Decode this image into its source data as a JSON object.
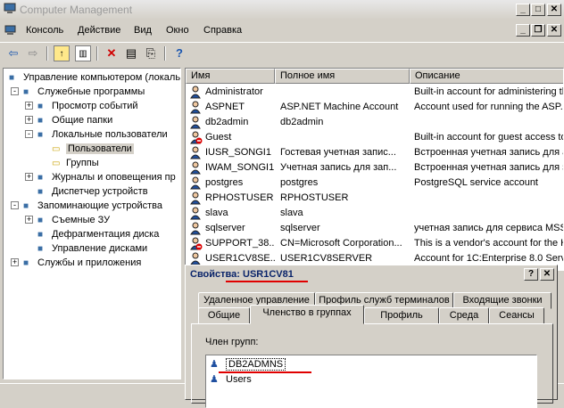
{
  "window": {
    "title": "Computer Management"
  },
  "menu": [
    "Консоль",
    "Действие",
    "Вид",
    "Окно",
    "Справка"
  ],
  "tree": {
    "items": [
      {
        "label": "Управление компьютером (локаль",
        "level": 0,
        "exp": ""
      },
      {
        "label": "Служебные программы",
        "level": 1,
        "exp": "-"
      },
      {
        "label": "Просмотр событий",
        "level": 2,
        "exp": "+"
      },
      {
        "label": "Общие папки",
        "level": 2,
        "exp": "+"
      },
      {
        "label": "Локальные пользователи",
        "level": 2,
        "exp": "-"
      },
      {
        "label": "Пользователи",
        "level": 3,
        "exp": ""
      },
      {
        "label": "Группы",
        "level": 3,
        "exp": ""
      },
      {
        "label": "Журналы и оповещения пр",
        "level": 2,
        "exp": "+"
      },
      {
        "label": "Диспетчер устройств",
        "level": 2,
        "exp": ""
      },
      {
        "label": "Запоминающие устройства",
        "level": 1,
        "exp": "-"
      },
      {
        "label": "Съемные ЗУ",
        "level": 2,
        "exp": "+"
      },
      {
        "label": "Дефрагментация диска",
        "level": 2,
        "exp": ""
      },
      {
        "label": "Управление дисками",
        "level": 2,
        "exp": ""
      },
      {
        "label": "Службы и приложения",
        "level": 1,
        "exp": "+"
      }
    ]
  },
  "list": {
    "columns": [
      "Имя",
      "Полное имя",
      "Описание"
    ],
    "rows": [
      {
        "name": "Administrator",
        "full": "",
        "desc": "Built-in account for administering th",
        "disabled": false
      },
      {
        "name": "ASPNET",
        "full": "ASP.NET Machine Account",
        "desc": "Account used for running the ASP.N",
        "disabled": false
      },
      {
        "name": "db2admin",
        "full": "db2admin",
        "desc": "",
        "disabled": false
      },
      {
        "name": "Guest",
        "full": "",
        "desc": "Built-in account for guest access to",
        "disabled": true
      },
      {
        "name": "IUSR_SONGI1",
        "full": "Гостевая учетная запис...",
        "desc": "Встроенная учетная запись для анониг",
        "disabled": false
      },
      {
        "name": "IWAM_SONGI1",
        "full": "Учетная запись для зап...",
        "desc": "Встроенная учетная запись для запус",
        "disabled": false
      },
      {
        "name": "postgres",
        "full": "postgres",
        "desc": "PostgreSQL service account",
        "disabled": false
      },
      {
        "name": "RPHOSTUSER",
        "full": "RPHOSTUSER",
        "desc": "",
        "disabled": false
      },
      {
        "name": "slava",
        "full": "slava",
        "desc": "",
        "disabled": false
      },
      {
        "name": "sqlserver",
        "full": "sqlserver",
        "desc": "учетная запись для сервиса MSS",
        "disabled": false
      },
      {
        "name": "SUPPORT_38...",
        "full": "CN=Microsoft Corporation...",
        "desc": "This is a vendor's account for the H",
        "disabled": true
      },
      {
        "name": "USER1CV8SE...",
        "full": "USER1CV8SERVER",
        "desc": "Account for 1C:Enterprise 8.0 Serv",
        "disabled": false
      }
    ]
  },
  "dialog": {
    "title": "Свойства: USR1CV81",
    "tabs_row1": [
      "Удаленное управление",
      "Профиль служб терминалов",
      "Входящие звонки"
    ],
    "tabs_row2": [
      "Общие",
      "Членство в группах",
      "Профиль",
      "Среда",
      "Сеансы"
    ],
    "active_tab": "Членство в группах",
    "member_label": "Член групп:",
    "members": [
      "DB2ADMNS",
      "Users"
    ]
  },
  "colors": {
    "underline": "#e00000",
    "selection": "#d4d0c8"
  }
}
